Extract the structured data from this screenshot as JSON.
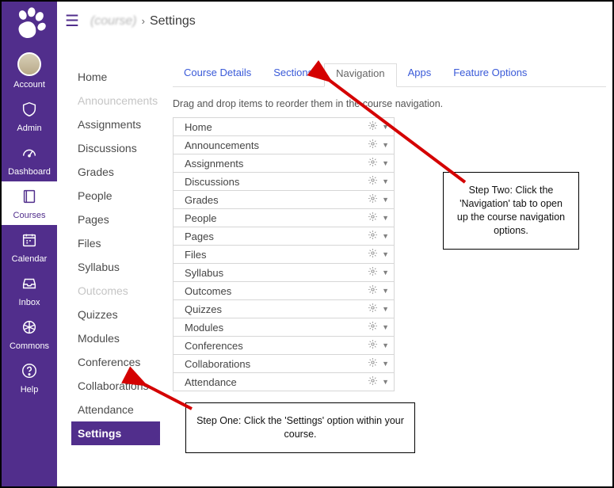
{
  "brand": {
    "primary_color": "#512e8c"
  },
  "crumbs": {
    "course_link": "(course)",
    "separator": "›",
    "current": "Settings"
  },
  "global_nav": [
    {
      "id": "account",
      "label": "Account",
      "icon": "avatar"
    },
    {
      "id": "admin",
      "label": "Admin",
      "icon": "shield"
    },
    {
      "id": "dashboard",
      "label": "Dashboard",
      "icon": "gauge"
    },
    {
      "id": "courses",
      "label": "Courses",
      "icon": "book",
      "active": true
    },
    {
      "id": "calendar",
      "label": "Calendar",
      "icon": "calendar"
    },
    {
      "id": "inbox",
      "label": "Inbox",
      "icon": "inbox"
    },
    {
      "id": "commons",
      "label": "Commons",
      "icon": "share"
    },
    {
      "id": "help",
      "label": "Help",
      "icon": "help"
    }
  ],
  "course_nav": [
    {
      "label": "Home"
    },
    {
      "label": "Announcements",
      "muted": true
    },
    {
      "label": "Assignments"
    },
    {
      "label": "Discussions"
    },
    {
      "label": "Grades"
    },
    {
      "label": "People"
    },
    {
      "label": "Pages"
    },
    {
      "label": "Files"
    },
    {
      "label": "Syllabus"
    },
    {
      "label": "Outcomes",
      "muted": true
    },
    {
      "label": "Quizzes"
    },
    {
      "label": "Modules"
    },
    {
      "label": "Conferences"
    },
    {
      "label": "Collaborations"
    },
    {
      "label": "Attendance"
    },
    {
      "label": "Settings",
      "active": true
    }
  ],
  "settings_tabs": {
    "items": [
      {
        "label": "Course Details"
      },
      {
        "label": "Sections"
      },
      {
        "label": "Navigation",
        "selected": true
      },
      {
        "label": "Apps"
      },
      {
        "label": "Feature Options"
      }
    ],
    "drag_prompt": "Drag and drop items to reorder them in the course navigation."
  },
  "reorder_items": [
    "Home",
    "Announcements",
    "Assignments",
    "Discussions",
    "Grades",
    "People",
    "Pages",
    "Files",
    "Syllabus",
    "Outcomes",
    "Quizzes",
    "Modules",
    "Conferences",
    "Collaborations",
    "Attendance"
  ],
  "callouts": {
    "one": "Step One: Click the 'Settings' option within your course.",
    "two": "Step Two: Click the 'Navigation' tab to open up the course navigation options."
  }
}
